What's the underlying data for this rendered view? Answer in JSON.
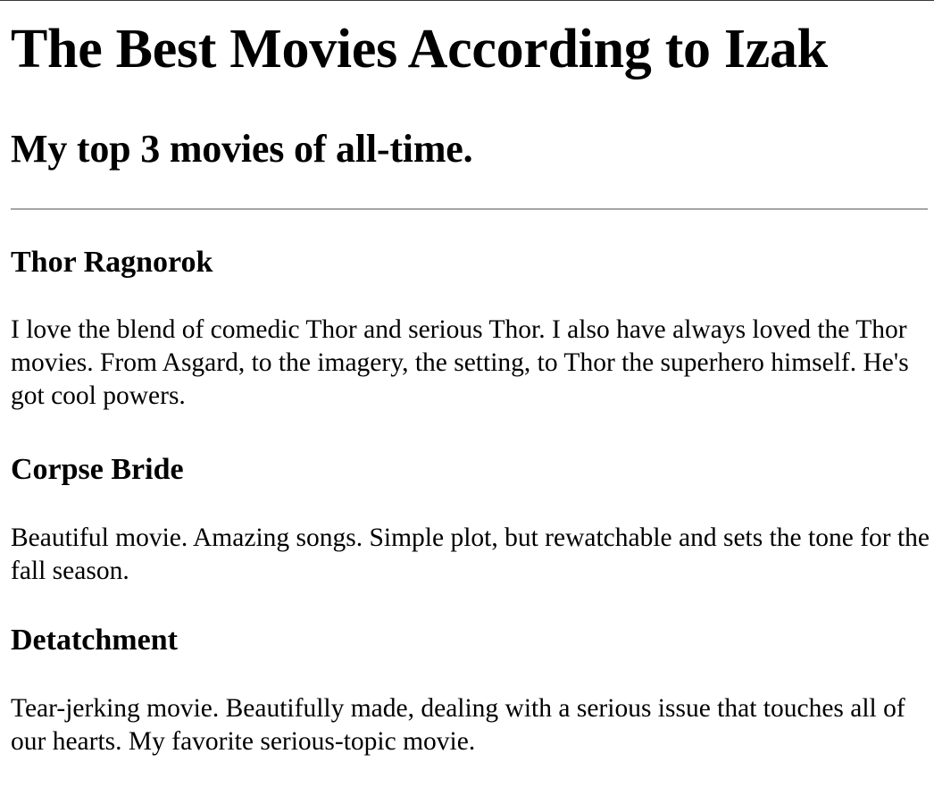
{
  "page": {
    "title": "The Best Movies According to Izak",
    "subtitle": "My top 3 movies of all-time."
  },
  "movies": [
    {
      "title": "Thor Ragnorok",
      "description": "I love the blend of comedic Thor and serious Thor. I also have always loved the Thor movies. From Asgard, to the imagery, the setting, to Thor the superhero himself. He's got cool powers."
    },
    {
      "title": "Corpse Bride",
      "description": "Beautiful movie. Amazing songs. Simple plot, but rewatchable and sets the tone for the fall season."
    },
    {
      "title": "Detatchment",
      "description": "Tear-jerking movie. Beautifully made, dealing with a serious issue that touches all of our hearts. My favorite serious-topic movie."
    }
  ]
}
